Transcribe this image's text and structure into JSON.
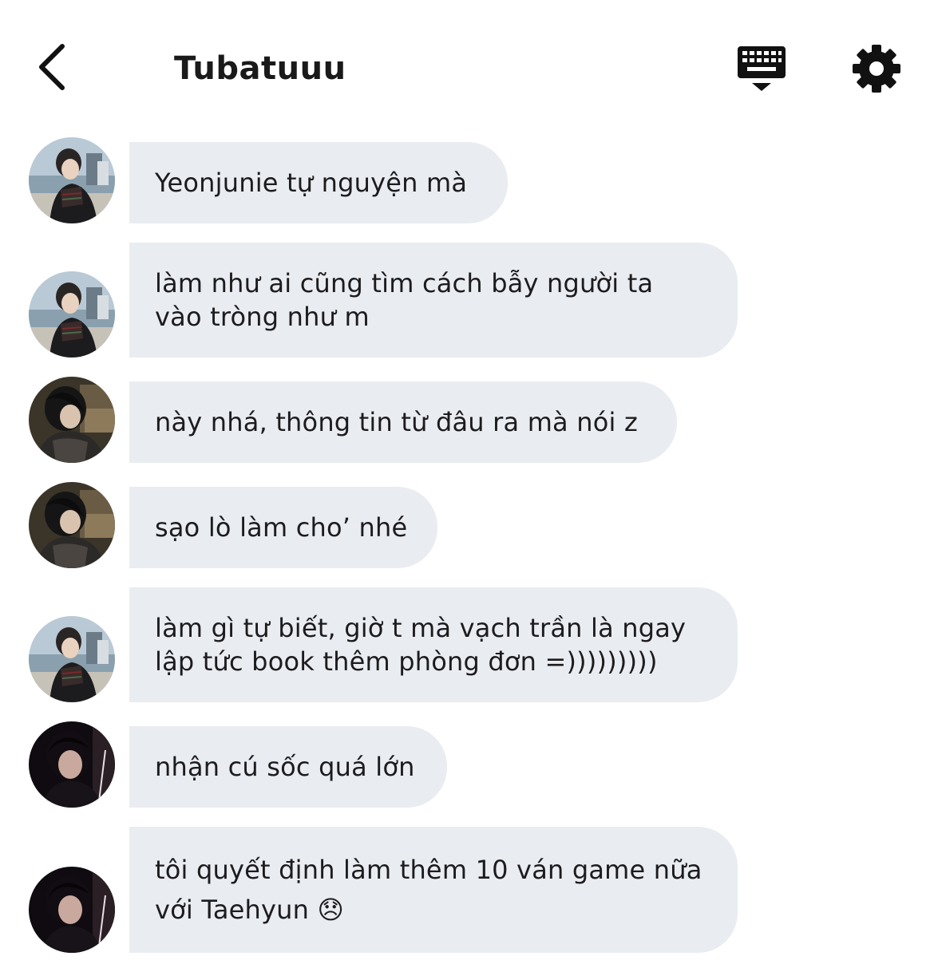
{
  "header": {
    "title": "Tubatuuu"
  },
  "icons": {
    "back": "chevron-left-icon",
    "keyboard": "keyboard-icon",
    "settings": "gear-icon"
  },
  "colors": {
    "bubble": "#e9ecf1",
    "text": "#1c1c1e",
    "background": "#ffffff"
  },
  "messages": [
    {
      "avatar": "avatar-a",
      "text": "Yeonjunie tự nguyện mà"
    },
    {
      "avatar": "avatar-a",
      "text": "làm như ai cũng tìm cách bẫy người ta\nvào tròng như m"
    },
    {
      "avatar": "avatar-b",
      "text": "này nhá, thông tin từ đâu ra mà nói z"
    },
    {
      "avatar": "avatar-b",
      "text": "sạo lò làm cho’ nhé"
    },
    {
      "avatar": "avatar-a",
      "text": "làm gì tự biết, giờ t mà vạch trần là ngay\nlập tức book thêm phòng đơn =)))))))))"
    },
    {
      "avatar": "avatar-c",
      "text": "nhận cú sốc quá lớn"
    },
    {
      "avatar": "avatar-c",
      "text": "tôi quyết định làm thêm 10 ván game nữa\nvới Taehyun 😞"
    }
  ]
}
